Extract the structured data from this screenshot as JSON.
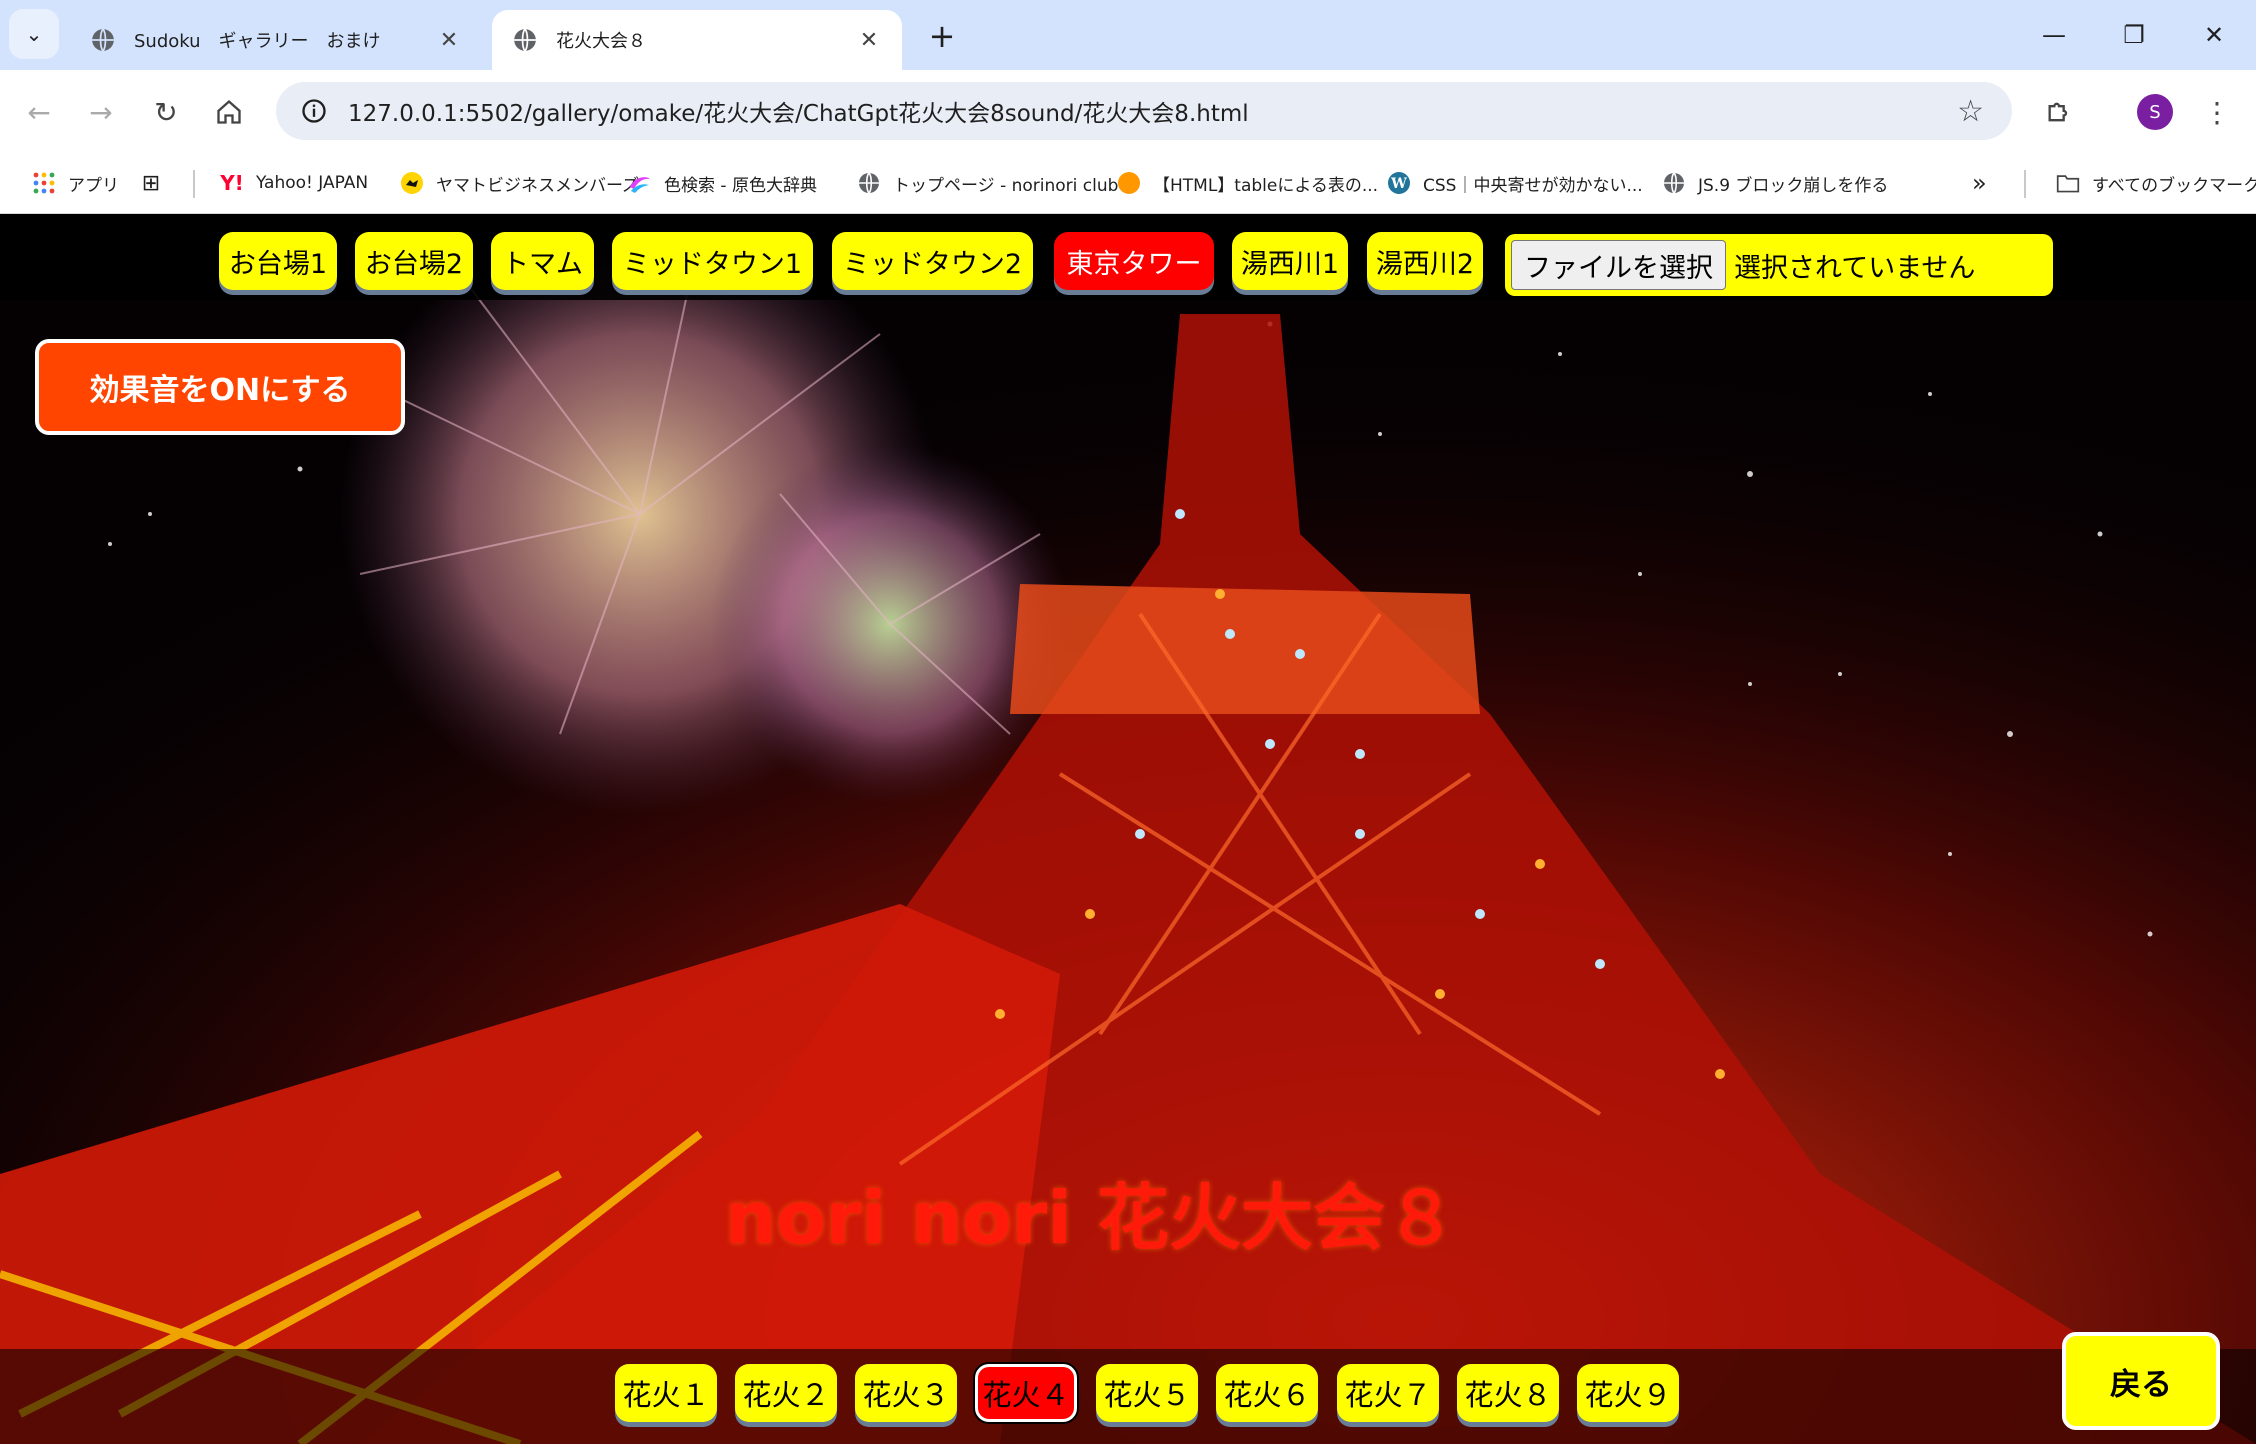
{
  "browser": {
    "tabs": [
      {
        "title": "Sudoku　ギャラリー　おまけ",
        "active": false
      },
      {
        "title": "花火大会８",
        "active": true
      }
    ],
    "url": "127.0.0.1:5502/gallery/omake/花火大会/ChatGpt花火大会8sound/花火大会8.html",
    "profile_initial": "S",
    "bookmarks": [
      "アプリ",
      "Yahoo! JAPAN",
      "ヤマトビジネスメンバーズ",
      "色検索 - 原色大辞典",
      "トップページ - norinori club",
      "【HTML】tableによる表の...",
      "CSS｜中央寄せが効かない...",
      "JS.9 ブロック崩しを作る"
    ],
    "all_bookmarks": "すべてのブックマーク"
  },
  "page": {
    "venues": [
      "お台場1",
      "お台場2",
      "トマム",
      "ミッドタウン1",
      "ミッドタウン2",
      "東京タワー",
      "湯西川1",
      "湯西川2"
    ],
    "active_venue": "東京タワー",
    "file_button": "ファイルを選択",
    "file_status": "選択されていません",
    "sound_button": "効果音をONにする",
    "title": "nori nori 花火大会８",
    "fireworks": [
      "花火１",
      "花火２",
      "花火３",
      "花火４",
      "花火５",
      "花火６",
      "花火７",
      "花火８",
      "花火９"
    ],
    "active_firework": "花火４",
    "back_button": "戻る"
  },
  "colors": {
    "button_yellow": "#ffff00",
    "active_red": "#ff0000",
    "sound_orange": "#ff4500",
    "title_red": "#ff1a0a",
    "chrome_blue": "#d3e3fd"
  }
}
